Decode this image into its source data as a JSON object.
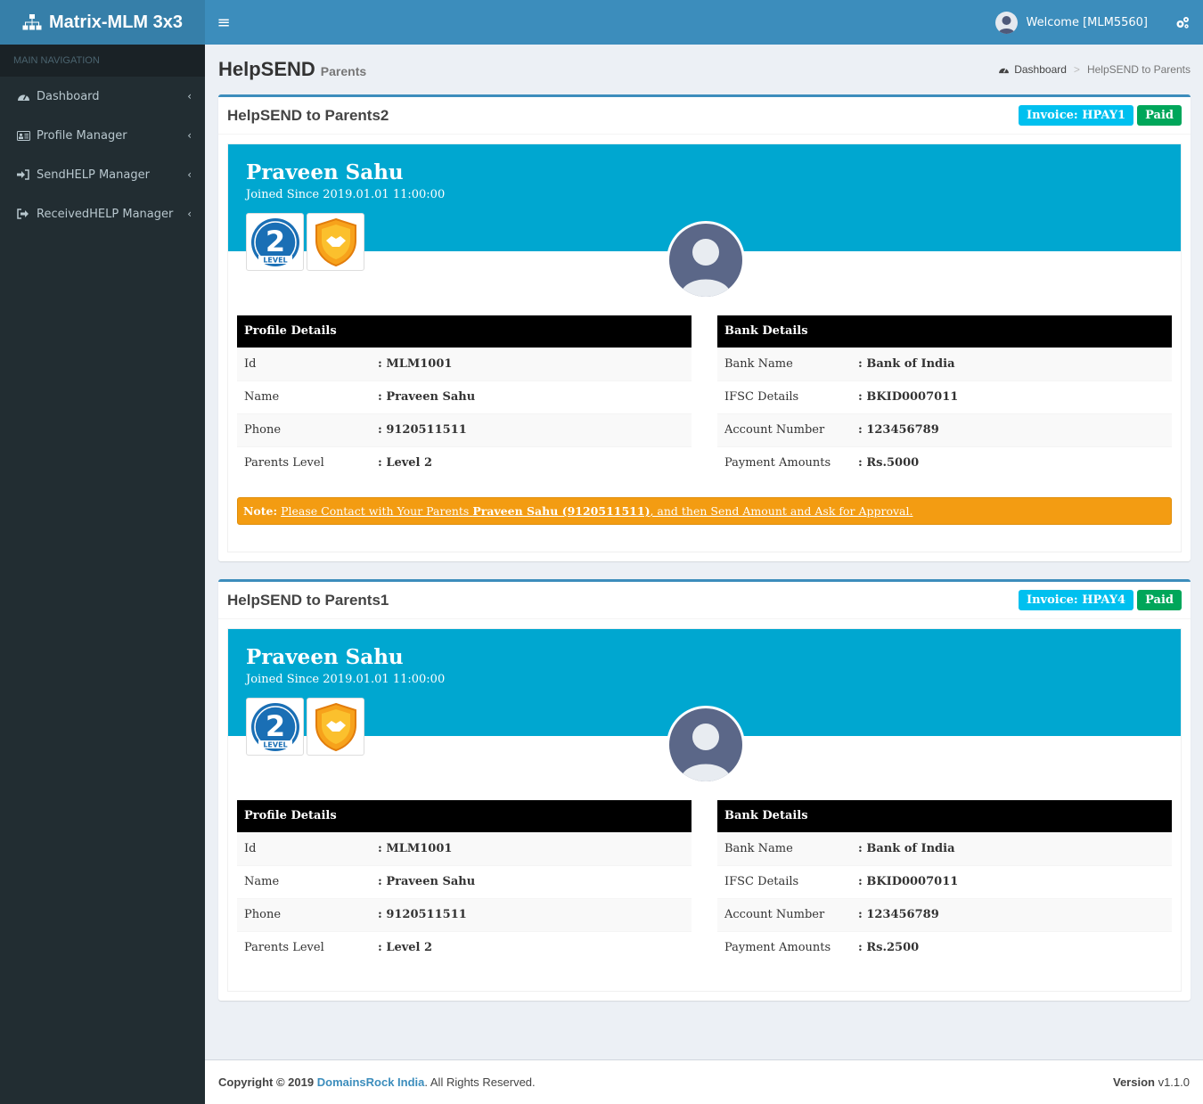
{
  "app": {
    "logo": "Matrix-MLM 3x3"
  },
  "sidebar": {
    "header": "MAIN NAVIGATION",
    "items": [
      {
        "label": "Dashboard",
        "icon": "dashboard-icon"
      },
      {
        "label": "Profile Manager",
        "icon": "id-card-icon"
      },
      {
        "label": "SendHELP Manager",
        "icon": "sign-in-icon"
      },
      {
        "label": "ReceivedHELP Manager",
        "icon": "sign-out-icon"
      }
    ]
  },
  "topbar": {
    "welcome": "Welcome [MLM5560]"
  },
  "header": {
    "title": "HelpSEND",
    "subtitle": "Parents",
    "breadcrumb": {
      "home": "Dashboard",
      "current": "HelpSEND to Parents"
    }
  },
  "colors": {
    "primary": "#3c8dbc",
    "sidebar": "#222d32",
    "widget": "#00a7d0",
    "paid": "#00a65a",
    "invoice": "#00c0ef",
    "warning": "#f39c12"
  },
  "cards": [
    {
      "title": "HelpSEND to Parents2",
      "invoice": "Invoice: HPAY1",
      "status": "Paid",
      "name": "Praveen Sahu",
      "joined": "Joined Since 2019.01.01 11:00:00",
      "badge_level_number": "2",
      "badge_level_text": "LEVEL",
      "profile": {
        "heading": "Profile Details",
        "rows": [
          {
            "k": "Id",
            "v": ": MLM1001"
          },
          {
            "k": "Name",
            "v": ": Praveen Sahu"
          },
          {
            "k": "Phone",
            "v": ": 9120511511"
          },
          {
            "k": "Parents Level",
            "v": ": Level 2"
          }
        ]
      },
      "bank": {
        "heading": "Bank Details",
        "rows": [
          {
            "k": "Bank Name",
            "v": ": Bank of India"
          },
          {
            "k": "IFSC Details",
            "v": ": BKID0007011"
          },
          {
            "k": "Account Number",
            "v": ": 123456789"
          },
          {
            "k": "Payment Amounts",
            "v": ": Rs.5000"
          }
        ]
      },
      "note": {
        "lead": "Note:",
        "pre": "Please Contact with Your Parents ",
        "bold": "Praveen Sahu (9120511511)",
        "post": ", and then Send Amount and Ask for Approval."
      }
    },
    {
      "title": "HelpSEND to Parents1",
      "invoice": "Invoice: HPAY4",
      "status": "Paid",
      "name": "Praveen Sahu",
      "joined": "Joined Since 2019.01.01 11:00:00",
      "badge_level_number": "2",
      "badge_level_text": "LEVEL",
      "profile": {
        "heading": "Profile Details",
        "rows": [
          {
            "k": "Id",
            "v": ": MLM1001"
          },
          {
            "k": "Name",
            "v": ": Praveen Sahu"
          },
          {
            "k": "Phone",
            "v": ": 9120511511"
          },
          {
            "k": "Parents Level",
            "v": ": Level 2"
          }
        ]
      },
      "bank": {
        "heading": "Bank Details",
        "rows": [
          {
            "k": "Bank Name",
            "v": ": Bank of India"
          },
          {
            "k": "IFSC Details",
            "v": ": BKID0007011"
          },
          {
            "k": "Account Number",
            "v": ": 123456789"
          },
          {
            "k": "Payment Amounts",
            "v": ": Rs.2500"
          }
        ]
      }
    }
  ],
  "footer": {
    "copyright": "Copyright © 2019",
    "company": "DomainsRock India",
    "rights": ". All Rights Reserved.",
    "version_label": "Version",
    "version": "v1.1.0"
  }
}
